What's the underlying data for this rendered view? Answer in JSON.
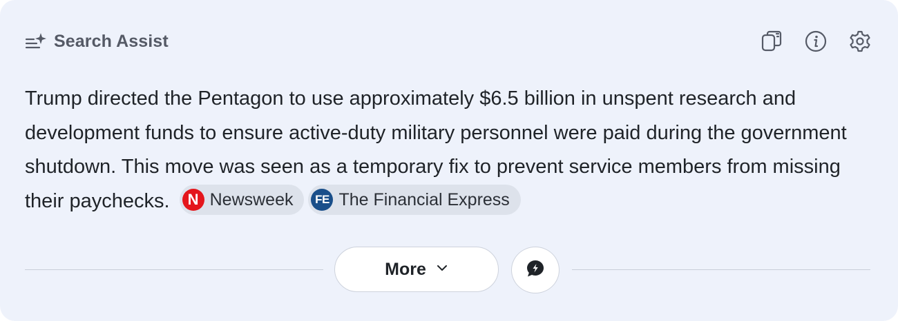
{
  "header": {
    "title": "Search Assist",
    "icons": [
      "sparkle-list-icon",
      "copy-icon",
      "info-icon",
      "gear-icon"
    ]
  },
  "answer": {
    "text": "Trump directed the Pentagon to use approximately $6.5 billion in unspent research and development funds to ensure active-duty military personnel were paid during the government shutdown. This move was seen as a temporary fix to prevent service members from missing their paychecks.",
    "sources": [
      {
        "name": "Newsweek",
        "logo": "N",
        "color": "#e4161c"
      },
      {
        "name": "The Financial Express",
        "logo": "FE",
        "color": "#1a4f8a"
      }
    ]
  },
  "footer": {
    "more_label": "More",
    "icons": [
      "chevron-down-icon",
      "chat-bubble-icon"
    ]
  },
  "colors": {
    "background": "#eef2fb",
    "text": "#1f2328",
    "muted": "#555a66"
  }
}
